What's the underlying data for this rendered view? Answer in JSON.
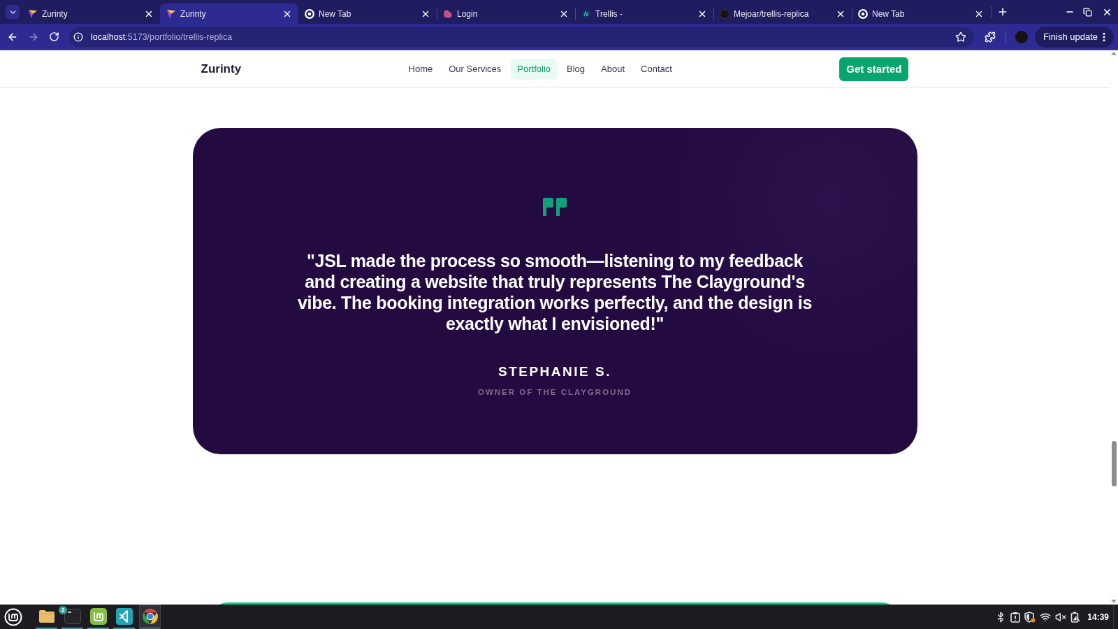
{
  "browser": {
    "tabs": [
      {
        "title": "Zurinty",
        "kind": "pennant",
        "selected": false
      },
      {
        "title": "Zurinty",
        "kind": "pennant",
        "selected": true
      },
      {
        "title": "New Tab",
        "kind": "ring",
        "selected": false
      },
      {
        "title": "Login",
        "kind": "blob",
        "selected": false
      },
      {
        "title": "Trellis -",
        "kind": "monogram",
        "selected": false
      },
      {
        "title": "Mejoar/trellis-replica",
        "kind": "circle",
        "selected": false
      },
      {
        "title": "New Tab",
        "kind": "ring",
        "selected": false
      }
    ],
    "forward_disabled": true,
    "address": {
      "host": "localhost",
      "path": ":5173/portfolio/trellis-replica"
    },
    "update_button": "Finish update"
  },
  "site": {
    "logo": "Zurinty",
    "nav": [
      {
        "label": "Home",
        "selected": false
      },
      {
        "label": "Our Services",
        "selected": false
      },
      {
        "label": "Portfolio",
        "selected": true
      },
      {
        "label": "Blog",
        "selected": false
      },
      {
        "label": "About",
        "selected": false
      },
      {
        "label": "Contact",
        "selected": false
      }
    ],
    "cta": "Get started",
    "testimonial": {
      "quote": "\"JSL made the process so smooth—listening to my feedback and creating a website that truly represents The Clayground's vibe. The booking integration works perfectly, and the design is exactly what I envisioned!\"",
      "name": "STEPHANIE S.",
      "role": "OWNER OF THE CLAYGROUND"
    }
  },
  "taskbar": {
    "apps": [
      {
        "kind": "files",
        "active": false
      },
      {
        "kind": "terminal",
        "active": false,
        "badge": "2"
      },
      {
        "kind": "updates",
        "active": false
      },
      {
        "kind": "editor",
        "active": false
      },
      {
        "kind": "browser",
        "active": true
      }
    ],
    "clock": "14:39"
  }
}
